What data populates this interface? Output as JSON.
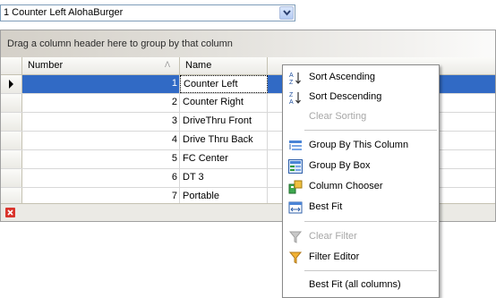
{
  "combo": {
    "value": "1 Counter Left AlohaBurger"
  },
  "grid": {
    "group_panel_text": "Drag a column header here to group by that column",
    "columns": [
      "Number",
      "Name"
    ],
    "rows": [
      {
        "number": "1",
        "name": "Counter Left"
      },
      {
        "number": "2",
        "name": "Counter Right"
      },
      {
        "number": "3",
        "name": "DriveThru Front"
      },
      {
        "number": "4",
        "name": "Drive Thru Back"
      },
      {
        "number": "5",
        "name": "FC Center"
      },
      {
        "number": "6",
        "name": "DT 3"
      },
      {
        "number": "7",
        "name": "Portable"
      }
    ],
    "selected_row": 0
  },
  "menu": {
    "sort_ascending": "Sort Ascending",
    "sort_descending": "Sort Descending",
    "clear_sorting": "Clear Sorting",
    "group_by_column": "Group By This Column",
    "group_by_box": "Group By Box",
    "column_chooser": "Column Chooser",
    "best_fit": "Best Fit",
    "clear_filter": "Clear Filter",
    "filter_editor": "Filter Editor",
    "best_fit_all": "Best Fit (all columns)"
  },
  "colors": {
    "selection": "#316ac5",
    "header_bg": "#ebeae5",
    "clear_filter_red": "#d9342b"
  }
}
